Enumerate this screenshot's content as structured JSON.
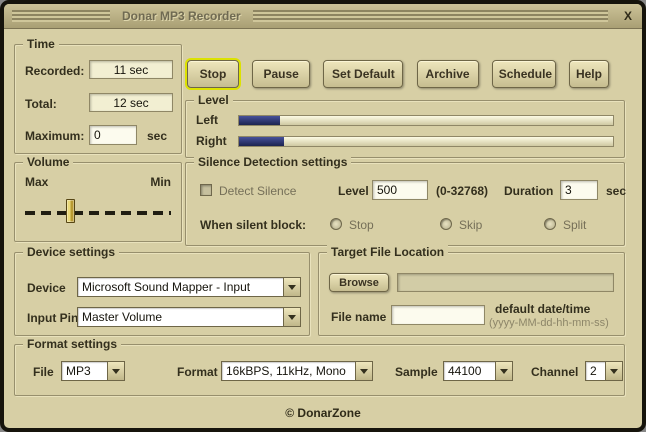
{
  "window": {
    "title": "Donar MP3 Recorder",
    "close": "X"
  },
  "colors": {
    "accent_focus": "#dce200",
    "level_fill": "#2b3468",
    "background": "#d7cfa5"
  },
  "time": {
    "label": "Time",
    "recorded_label": "Recorded:",
    "recorded_value": "11 sec",
    "total_label": "Total:",
    "total_value": "12 sec",
    "maximum_label": "Maximum:",
    "maximum_value": "0",
    "maximum_unit": "sec"
  },
  "buttons": [
    {
      "label": "Stop"
    },
    {
      "label": "Pause"
    },
    {
      "label": "Set Default"
    },
    {
      "label": "Archive"
    },
    {
      "label": "Schedule"
    },
    {
      "label": "Help"
    }
  ],
  "level": {
    "label": "Level",
    "left_label": "Left",
    "right_label": "Right",
    "left_percent": 11,
    "right_percent": 12
  },
  "volume": {
    "label": "Volume",
    "max_label": "Max",
    "min_label": "Min",
    "position_percent": 31
  },
  "silence": {
    "label": "Silence Detection settings",
    "detect_label": "Detect Silence",
    "level_label": "Level",
    "level_value": "500",
    "level_range": "(0-32768)",
    "duration_label": "Duration",
    "duration_value": "3",
    "duration_unit": "sec",
    "when_label": "When silent block:",
    "options": [
      {
        "label": "Stop"
      },
      {
        "label": "Skip"
      },
      {
        "label": "Split"
      }
    ]
  },
  "device": {
    "label": "Device settings",
    "device_label": "Device",
    "device_value": "Microsoft Sound Mapper - Input",
    "input_pin_label": "Input Pin",
    "input_pin_value": "Master Volume"
  },
  "target": {
    "label": "Target File Location",
    "browse_label": "Browse",
    "path_value": "",
    "file_name_label": "File name",
    "file_name_value": "",
    "hint_line1": "default date/time",
    "hint_line2": "(yyyy-MM-dd-hh-mm-ss)"
  },
  "format": {
    "label": "Format settings",
    "file_label": "File",
    "file_value": "MP3",
    "format_label": "Format",
    "format_value": "16kBPS, 11kHz, Mono",
    "sample_label": "Sample",
    "sample_value": "44100",
    "channel_label": "Channel",
    "channel_value": "2"
  },
  "footer": {
    "copyright": "© DonarZone"
  }
}
